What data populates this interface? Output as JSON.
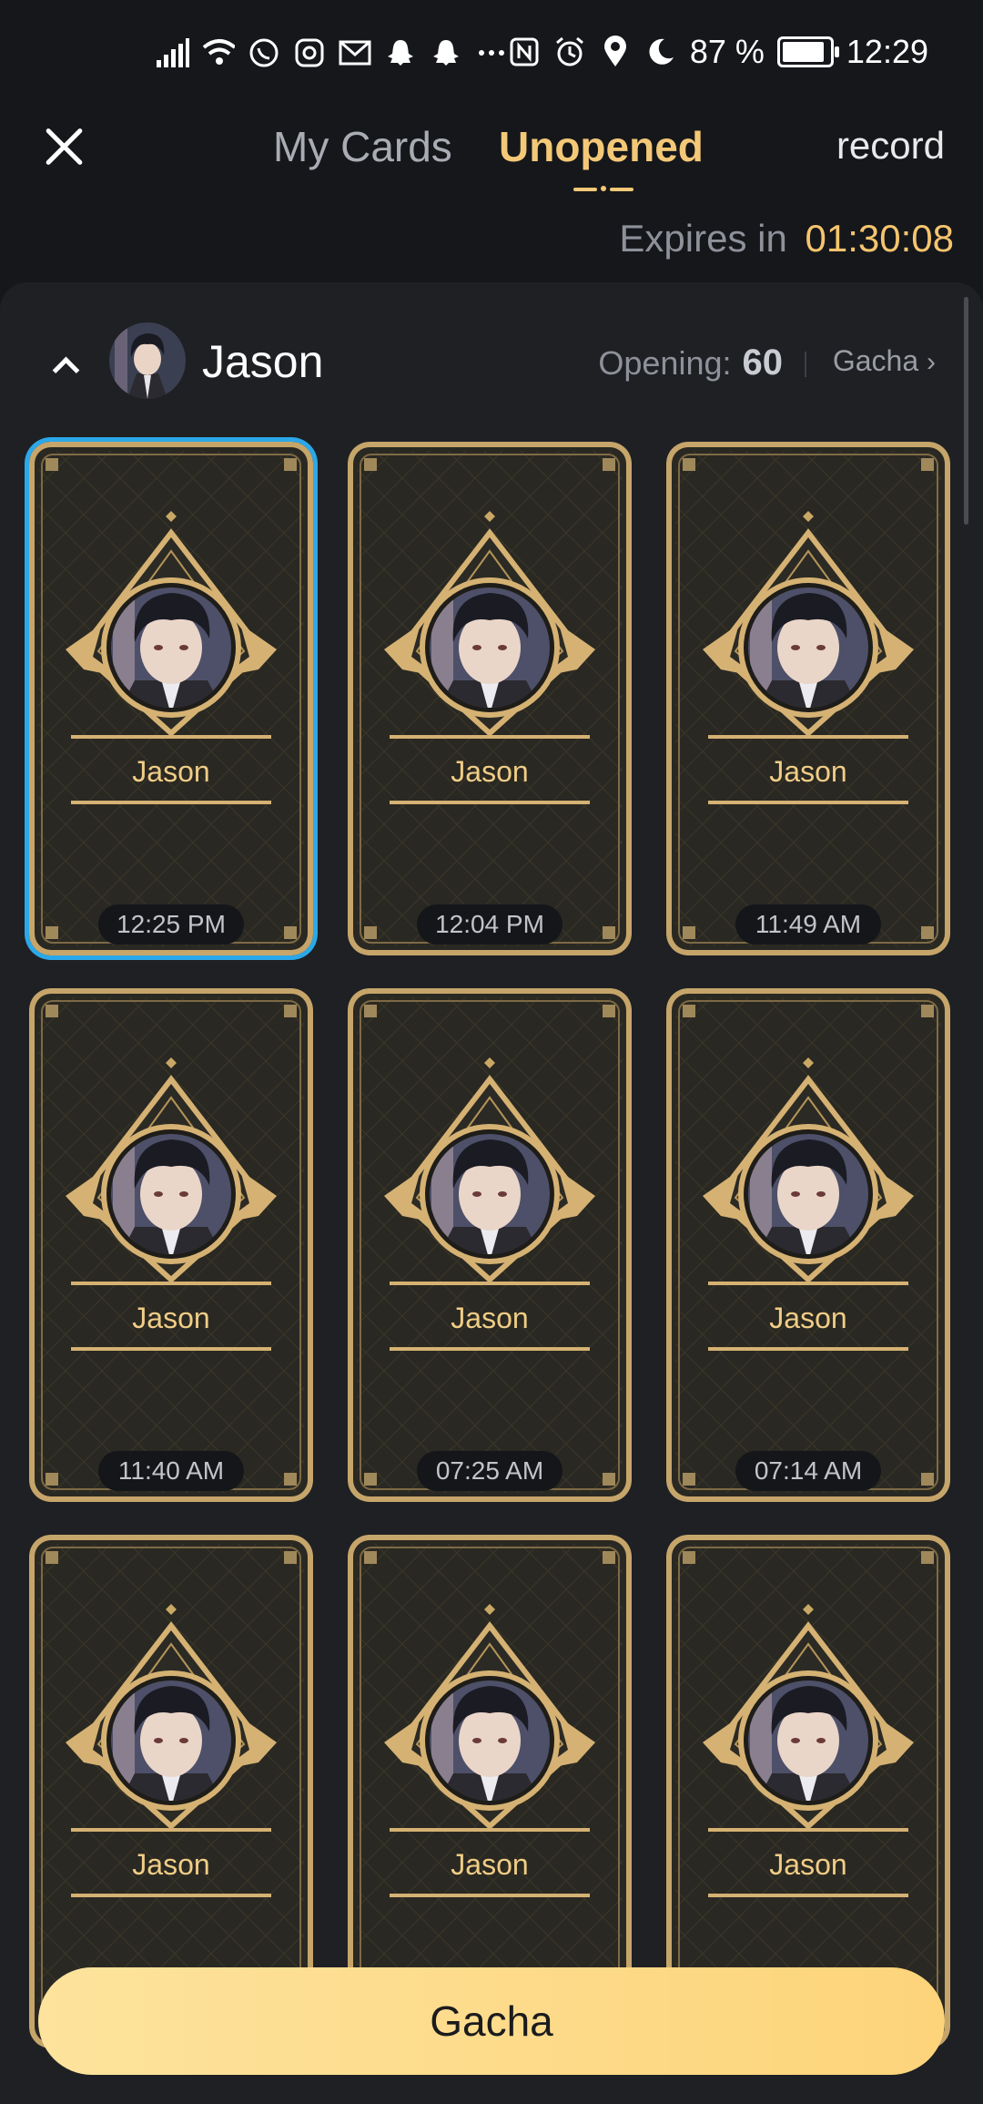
{
  "status_bar": {
    "battery_percent": "87 %",
    "clock": "12:29",
    "icons": [
      "signal-icon",
      "wifi-icon",
      "whatsapp-icon",
      "instagram-icon",
      "mail-icon",
      "snapchat-icon",
      "snapchat-icon",
      "more-icon",
      "nfc-icon",
      "alarm-icon",
      "location-icon",
      "moon-icon",
      "battery-icon"
    ]
  },
  "header": {
    "tabs": [
      {
        "label": "My Cards",
        "active": false
      },
      {
        "label": "Unopened",
        "active": true
      }
    ],
    "record_label": "record",
    "expires_label": "Expires in",
    "expires_time": "01:30:08"
  },
  "group": {
    "name": "Jason",
    "opening_label": "Opening:",
    "opening_count": "60",
    "gacha_link": "Gacha"
  },
  "cards": [
    {
      "name": "Jason",
      "time": "12:25 PM",
      "selected": true
    },
    {
      "name": "Jason",
      "time": "12:04 PM",
      "selected": false
    },
    {
      "name": "Jason",
      "time": "11:49 AM",
      "selected": false
    },
    {
      "name": "Jason",
      "time": "11:40 AM",
      "selected": false
    },
    {
      "name": "Jason",
      "time": "07:25 AM",
      "selected": false
    },
    {
      "name": "Jason",
      "time": "07:14 AM",
      "selected": false
    },
    {
      "name": "Jason",
      "time": "",
      "selected": false
    },
    {
      "name": "Jason",
      "time": "",
      "selected": false
    },
    {
      "name": "Jason",
      "time": "",
      "selected": false
    }
  ],
  "footer": {
    "gacha_button": "Gacha"
  },
  "colors": {
    "accent": "#f3c877",
    "selected_border": "#2ba8e9",
    "button": "#fdd98a"
  }
}
